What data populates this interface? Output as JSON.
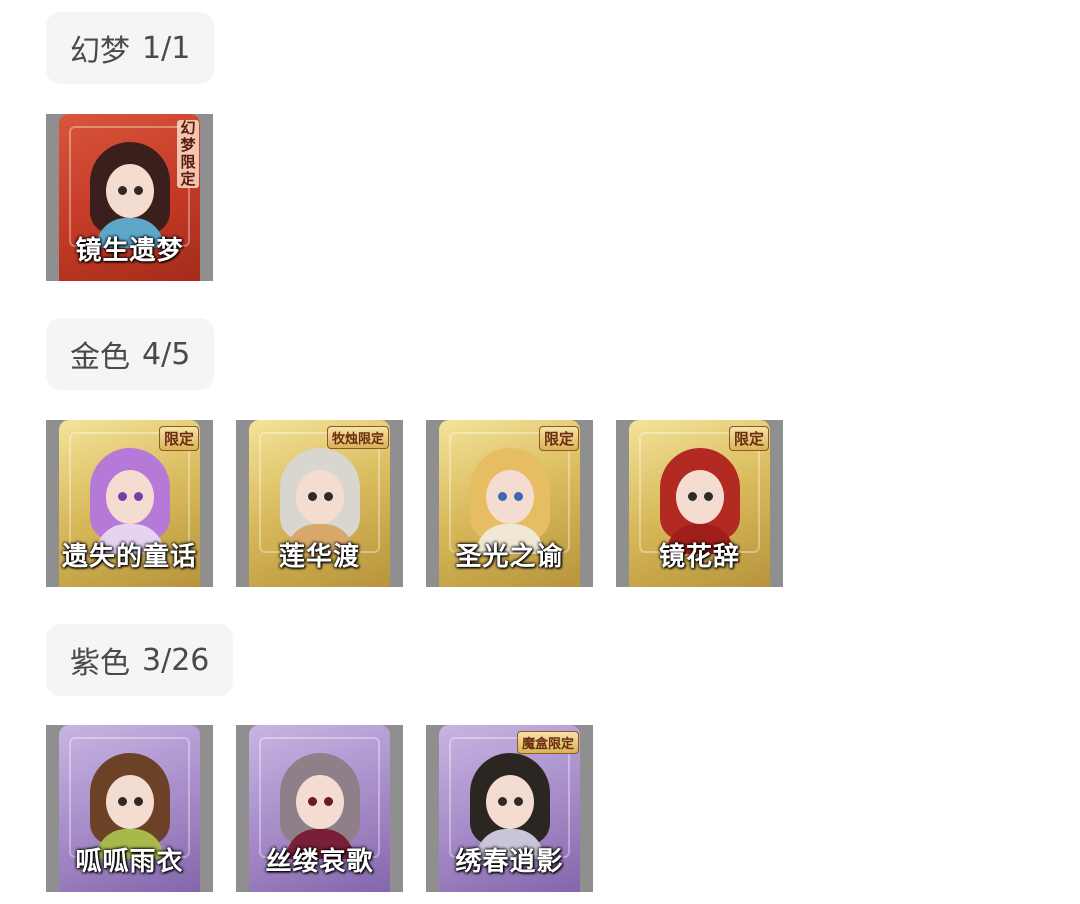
{
  "sections": [
    {
      "tier": "幻梦",
      "count": "1/1",
      "items": [
        {
          "name": "镜生遗梦",
          "badge": "幻梦限定",
          "frame": "red"
        }
      ]
    },
    {
      "tier": "金色",
      "count": "4/5",
      "items": [
        {
          "name": "遗失的童话",
          "badge": "限定",
          "frame": "gold"
        },
        {
          "name": "莲华渡",
          "badge": "牧烛限定",
          "frame": "gold"
        },
        {
          "name": "圣光之谕",
          "badge": "限定",
          "frame": "gold"
        },
        {
          "name": "镜花辞",
          "badge": "限定",
          "frame": "gold"
        }
      ]
    },
    {
      "tier": "紫色",
      "count": "3/26",
      "items": [
        {
          "name": "呱呱雨衣",
          "frame": "purple"
        },
        {
          "name": "丝缕哀歌",
          "frame": "purple"
        },
        {
          "name": "绣春逍影",
          "badge": "魔盒限定",
          "frame": "purple"
        }
      ]
    }
  ]
}
